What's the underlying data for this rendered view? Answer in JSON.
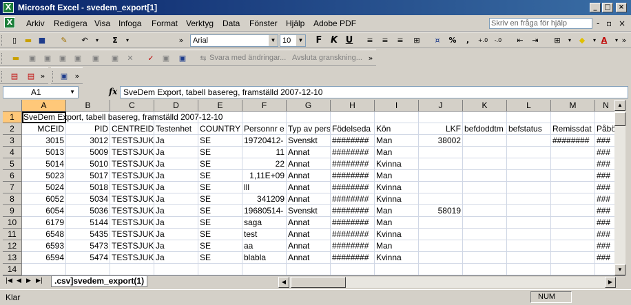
{
  "window": {
    "title": "Microsoft Excel - svedem_export[1]",
    "app_icon_glyph": "X"
  },
  "menu": [
    {
      "name": "arkiv",
      "label": "Arkiv"
    },
    {
      "name": "redigera",
      "label": "Redigera"
    },
    {
      "name": "visa",
      "label": "Visa"
    },
    {
      "name": "infoga",
      "label": "Infoga"
    },
    {
      "name": "format",
      "label": "Format"
    },
    {
      "name": "verktyg",
      "label": "Verktyg"
    },
    {
      "name": "data",
      "label": "Data"
    },
    {
      "name": "fonster",
      "label": "Fönster"
    },
    {
      "name": "hjalp",
      "label": "Hjälp"
    },
    {
      "name": "adobe-pdf",
      "label": "Adobe PDF"
    }
  ],
  "help": {
    "placeholder": "Skriv en fråga för hjälp"
  },
  "toolbar": {
    "font_name": "Arial",
    "font_size": "10",
    "sum_symbol": "Σ",
    "bold_label": "F",
    "italic_label": "K",
    "underline_label": "U",
    "percent_label": "%",
    "reply_label": "Svara med ändringar...",
    "end_review_label": "Avsluta granskning..."
  },
  "formula_bar": {
    "cell_ref": "A1",
    "fx_label": "fx",
    "content": "SveDem Export, tabell basereg, framställd 2007-12-10"
  },
  "columns": [
    "A",
    "B",
    "C",
    "D",
    "E",
    "F",
    "G",
    "H",
    "I",
    "J",
    "K",
    "L",
    "M",
    "N"
  ],
  "rows": [
    {
      "num": "1",
      "cells": [
        "SveDem Export, tabell basereg, framställd 2007-12-10",
        "",
        "",
        "",
        "",
        "",
        "",
        "",
        "",
        "",
        "",
        "",
        "",
        ""
      ]
    },
    {
      "num": "2",
      "cells": [
        "MCEID",
        "PID",
        "CENTREID",
        "Testenhet",
        "COUNTRY",
        "Personnr e",
        "Typ av pers",
        "Födelseda",
        "Kön",
        "LKF",
        "befdoddtm",
        "befstatus",
        "Remissdat",
        "Påbö"
      ]
    },
    {
      "num": "3",
      "cells": [
        "3015",
        "3012",
        "TESTSJUK",
        "Ja",
        "SE",
        "19720412-",
        "Svenskt",
        "########",
        "Man",
        "38002",
        "",
        "",
        "########",
        "###"
      ]
    },
    {
      "num": "4",
      "cells": [
        "5013",
        "5009",
        "TESTSJUK",
        "Ja",
        "SE",
        "11",
        "Annat",
        "########",
        "Man",
        "",
        "",
        "",
        "",
        "###"
      ]
    },
    {
      "num": "5",
      "cells": [
        "5014",
        "5010",
        "TESTSJUK",
        "Ja",
        "SE",
        "22",
        "Annat",
        "########",
        "Kvinna",
        "",
        "",
        "",
        "",
        "###"
      ]
    },
    {
      "num": "6",
      "cells": [
        "5023",
        "5017",
        "TESTSJUK",
        "Ja",
        "SE",
        "1,11E+09",
        "Annat",
        "########",
        "Man",
        "",
        "",
        "",
        "",
        "###"
      ]
    },
    {
      "num": "7",
      "cells": [
        "5024",
        "5018",
        "TESTSJUK",
        "Ja",
        "SE",
        "lll",
        "Annat",
        "########",
        "Kvinna",
        "",
        "",
        "",
        "",
        "###"
      ]
    },
    {
      "num": "8",
      "cells": [
        "6052",
        "5034",
        "TESTSJUK",
        "Ja",
        "SE",
        "341209",
        "Annat",
        "########",
        "Kvinna",
        "",
        "",
        "",
        "",
        "###"
      ]
    },
    {
      "num": "9",
      "cells": [
        "6054",
        "5036",
        "TESTSJUK",
        "Ja",
        "SE",
        "19680514-",
        "Svenskt",
        "########",
        "Man",
        "58019",
        "",
        "",
        "",
        "###"
      ]
    },
    {
      "num": "10",
      "cells": [
        "6179",
        "5144",
        "TESTSJUK",
        "Ja",
        "SE",
        "saga",
        "Annat",
        "########",
        "Man",
        "",
        "",
        "",
        "",
        "###"
      ]
    },
    {
      "num": "11",
      "cells": [
        "6548",
        "5435",
        "TESTSJUK",
        "Ja",
        "SE",
        "test",
        "Annat",
        "########",
        "Kvinna",
        "",
        "",
        "",
        "",
        "###"
      ]
    },
    {
      "num": "12",
      "cells": [
        "6593",
        "5473",
        "TESTSJUK",
        "Ja",
        "SE",
        "aa",
        "Annat",
        "########",
        "Man",
        "",
        "",
        "",
        "",
        "###"
      ]
    },
    {
      "num": "13",
      "cells": [
        "6594",
        "5474",
        "TESTSJUK",
        "Ja",
        "SE",
        "blabla",
        "Annat",
        "########",
        "Kvinna",
        "",
        "",
        "",
        "",
        "###"
      ]
    },
    {
      "num": "14",
      "cells": [
        "",
        "",
        "",
        "",
        "",
        "",
        "",
        "",
        "",
        "",
        "",
        "",
        "",
        ""
      ]
    }
  ],
  "sheet": {
    "tab_label": ".csv]svedem_export(1)"
  },
  "status": {
    "left": "Klar",
    "num": "NUM"
  }
}
